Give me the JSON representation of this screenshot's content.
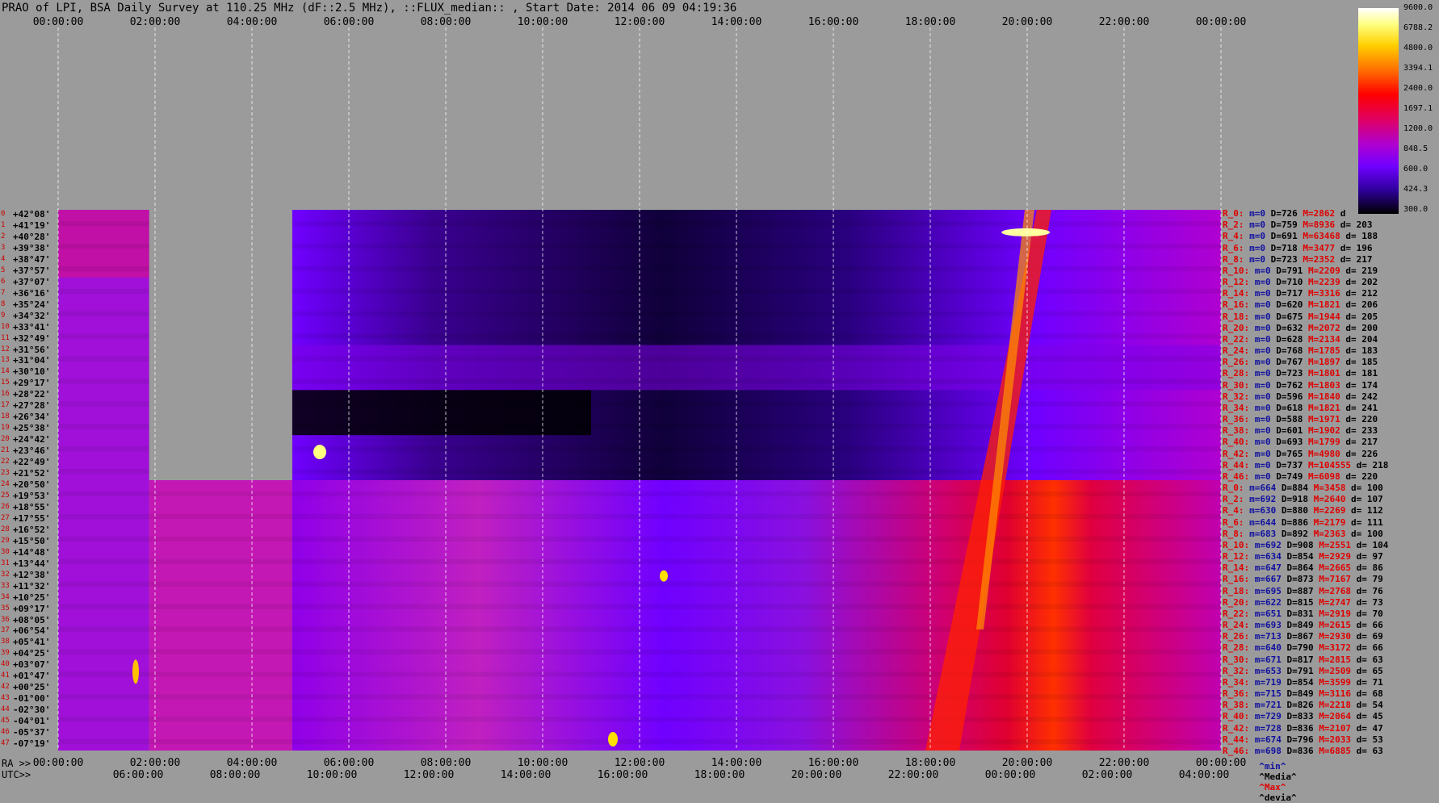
{
  "title": "PRAO of LPI, BSA Daily Survey at 110.25 MHz (dF::2.5 MHz), ::FLUX_median:: , Start Date: 2014 06 09 04:19:36",
  "top_axis": [
    "00:00:00",
    "02:00:00",
    "04:00:00",
    "06:00:00",
    "08:00:00",
    "10:00:00",
    "12:00:00",
    "14:00:00",
    "16:00:00",
    "18:00:00",
    "20:00:00",
    "22:00:00",
    "00:00:00"
  ],
  "bottom_axis_ra_label": "RA >>",
  "bottom_axis_ra": [
    "00:00:00",
    "02:00:00",
    "04:00:00",
    "06:00:00",
    "08:00:00",
    "10:00:00",
    "12:00:00",
    "14:00:00",
    "16:00:00",
    "18:00:00",
    "20:00:00",
    "22:00:00",
    "00:00:00"
  ],
  "bottom_axis_utc_label": "UTC>>",
  "bottom_axis_utc": [
    "06:00:00",
    "08:00:00",
    "10:00:00",
    "12:00:00",
    "14:00:00",
    "16:00:00",
    "18:00:00",
    "20:00:00",
    "22:00:00",
    "00:00:00",
    "02:00:00",
    "04:00:00"
  ],
  "colorbar_labels": [
    "9600.0",
    "6788.2",
    "4800.0",
    "3394.1",
    "2400.0",
    "1697.1",
    "1200.0",
    "848.5",
    "600.0",
    "424.3",
    "300.0"
  ],
  "legend": {
    "min": "^min^",
    "median": "^Media^",
    "max": "^Max^",
    "dev": "^devia^"
  },
  "declinations": [
    "+42°08'",
    "+41°19'",
    "+40°28'",
    "+39°38'",
    "+38°47'",
    "+37°57'",
    "+37°07'",
    "+36°16'",
    "+35°24'",
    "+34°32'",
    "+33°41'",
    "+32°49'",
    "+31°56'",
    "+31°04'",
    "+30°10'",
    "+29°17'",
    "+28°22'",
    "+27°28'",
    "+26°34'",
    "+25°38'",
    "+24°42'",
    "+23°46'",
    "+22°49'",
    "+21°52'",
    "+20°50'",
    "+19°53'",
    "+18°55'",
    "+17°55'",
    "+16°52'",
    "+15°50'",
    "+14°48'",
    "+13°44'",
    "+12°38'",
    "+11°32'",
    "+10°25'",
    "+09°17'",
    "+08°05'",
    "+06°54'",
    "+05°41'",
    "+04°25'",
    "+03°07'",
    "+01°47'",
    "+00°25'",
    "-01°00'",
    "-02°30'",
    "-04°01'",
    "-05°37'",
    "-07°19'"
  ],
  "stats": [
    [
      "R_0:",
      "m=0",
      "D=726",
      "M=2862",
      "d"
    ],
    [
      "R_2:",
      "m=0",
      "D=759",
      "M=8936",
      "d= 203"
    ],
    [
      "R_4:",
      "m=0",
      "D=691",
      "M=63468",
      "d= 188"
    ],
    [
      "R_6:",
      "m=0",
      "D=718",
      "M=3477",
      "d= 196"
    ],
    [
      "R_8:",
      "m=0",
      "D=723",
      "M=2352",
      "d= 217"
    ],
    [
      "R_10:",
      "m=0",
      "D=791",
      "M=2209",
      "d= 219"
    ],
    [
      "R_12:",
      "m=0",
      "D=710",
      "M=2239",
      "d= 202"
    ],
    [
      "R_14:",
      "m=0",
      "D=717",
      "M=3316",
      "d= 212"
    ],
    [
      "R_16:",
      "m=0",
      "D=620",
      "M=1821",
      "d= 206"
    ],
    [
      "R_18:",
      "m=0",
      "D=675",
      "M=1944",
      "d= 205"
    ],
    [
      "R_20:",
      "m=0",
      "D=632",
      "M=2072",
      "d= 200"
    ],
    [
      "R_22:",
      "m=0",
      "D=628",
      "M=2134",
      "d= 204"
    ],
    [
      "R_24:",
      "m=0",
      "D=768",
      "M=1785",
      "d= 183"
    ],
    [
      "R_26:",
      "m=0",
      "D=767",
      "M=1897",
      "d= 185"
    ],
    [
      "R_28:",
      "m=0",
      "D=723",
      "M=1801",
      "d= 181"
    ],
    [
      "R_30:",
      "m=0",
      "D=762",
      "M=1803",
      "d= 174"
    ],
    [
      "R_32:",
      "m=0",
      "D=596",
      "M=1840",
      "d= 242"
    ],
    [
      "R_34:",
      "m=0",
      "D=618",
      "M=1821",
      "d= 241"
    ],
    [
      "R_36:",
      "m=0",
      "D=588",
      "M=1971",
      "d= 220"
    ],
    [
      "R_38:",
      "m=0",
      "D=601",
      "M=1902",
      "d= 233"
    ],
    [
      "R_40:",
      "m=0",
      "D=693",
      "M=1799",
      "d= 217"
    ],
    [
      "R_42:",
      "m=0",
      "D=765",
      "M=4980",
      "d= 226"
    ],
    [
      "R_44:",
      "m=0",
      "D=737",
      "M=104555",
      "d= 218"
    ],
    [
      "R_46:",
      "m=0",
      "D=749",
      "M=6098",
      "d= 220"
    ],
    [
      "R_0:",
      "m=664",
      "D=884",
      "M=3458",
      "d= 100"
    ],
    [
      "R_2:",
      "m=692",
      "D=918",
      "M=2640",
      "d= 107"
    ],
    [
      "R_4:",
      "m=630",
      "D=880",
      "M=2269",
      "d= 112"
    ],
    [
      "R_6:",
      "m=644",
      "D=886",
      "M=2179",
      "d= 111"
    ],
    [
      "R_8:",
      "m=683",
      "D=892",
      "M=2363",
      "d= 100"
    ],
    [
      "R_10:",
      "m=692",
      "D=908",
      "M=2551",
      "d= 104"
    ],
    [
      "R_12:",
      "m=634",
      "D=854",
      "M=2929",
      "d= 97"
    ],
    [
      "R_14:",
      "m=647",
      "D=864",
      "M=2665",
      "d= 86"
    ],
    [
      "R_16:",
      "m=667",
      "D=873",
      "M=7167",
      "d= 79"
    ],
    [
      "R_18:",
      "m=695",
      "D=887",
      "M=2768",
      "d= 76"
    ],
    [
      "R_20:",
      "m=622",
      "D=815",
      "M=2747",
      "d= 73"
    ],
    [
      "R_22:",
      "m=651",
      "D=831",
      "M=2919",
      "d= 70"
    ],
    [
      "R_24:",
      "m=693",
      "D=849",
      "M=2615",
      "d= 66"
    ],
    [
      "R_26:",
      "m=713",
      "D=867",
      "M=2930",
      "d= 69"
    ],
    [
      "R_28:",
      "m=640",
      "D=790",
      "M=3172",
      "d= 66"
    ],
    [
      "R_30:",
      "m=671",
      "D=817",
      "M=2815",
      "d= 63"
    ],
    [
      "R_32:",
      "m=653",
      "D=791",
      "M=2509",
      "d= 65"
    ],
    [
      "R_34:",
      "m=719",
      "D=854",
      "M=3599",
      "d= 71"
    ],
    [
      "R_36:",
      "m=715",
      "D=849",
      "M=3116",
      "d= 68"
    ],
    [
      "R_38:",
      "m=721",
      "D=826",
      "M=2218",
      "d= 54"
    ],
    [
      "R_40:",
      "m=729",
      "D=833",
      "M=2064",
      "d= 45"
    ],
    [
      "R_42:",
      "m=728",
      "D=836",
      "M=2107",
      "d= 47"
    ],
    [
      "R_44:",
      "m=674",
      "D=796",
      "M=2033",
      "d= 53"
    ],
    [
      "R_46:",
      "m=698",
      "D=836",
      "M=6885",
      "d= 63"
    ]
  ],
  "chart_data": {
    "type": "heatmap",
    "title": "PRAO of LPI, BSA Daily Survey at 110.25 MHz (dF::2.5 MHz), ::FLUX_median:: , Start Date: 2014 06 09 04:19:36",
    "x_axis": "RA 00:00:00 to 24:00:00",
    "y_axis": "Declination +42°08' to -07°19'",
    "color_scale": "log, 300.0 to 9600.0",
    "gaps": [
      {
        "ra_start": "01:53",
        "ra_end": "04:50",
        "dec_rows": "all (0-47)"
      },
      {
        "ra_start": "04:50",
        "ra_end": "24:00",
        "dec_rows": "none; top block covers +42°08' to +21°52'"
      }
    ],
    "features": [
      {
        "name": "bright source",
        "ra": "19:58",
        "dec": "+40°28'"
      },
      {
        "name": "galactic plane band",
        "ra_range": "18:00-21:00",
        "dec_range": "+42° to -07°"
      },
      {
        "name": "bright source",
        "ra": "05:24",
        "dec": "+22°49'"
      },
      {
        "name": "bright source",
        "ra": "12:30",
        "dec": "+12°38'"
      },
      {
        "name": "bright source",
        "ra": "11:30",
        "dec": "-07°19'"
      }
    ]
  }
}
